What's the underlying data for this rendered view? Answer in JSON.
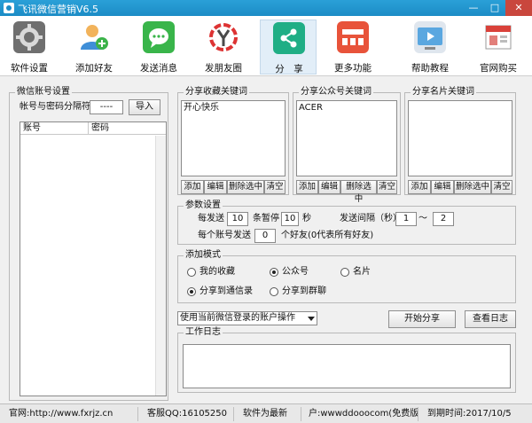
{
  "window": {
    "title": "飞讯微信营销V6.5",
    "minimize": "—",
    "maximize": "□",
    "close": "✕"
  },
  "toolbar": {
    "items": [
      {
        "label": "软件设置",
        "icon": "gear-icon"
      },
      {
        "label": "添加好友",
        "icon": "add-user-icon"
      },
      {
        "label": "发送消息",
        "icon": "chat-icon"
      },
      {
        "label": "发朋友圈",
        "icon": "moments-icon"
      },
      {
        "label": "分　享",
        "icon": "share-icon"
      },
      {
        "label": "更多功能",
        "icon": "more-icon"
      },
      {
        "label": "帮助教程",
        "icon": "help-video-icon"
      },
      {
        "label": "官网购买",
        "icon": "shop-icon"
      }
    ],
    "active": "分　享"
  },
  "accounts": {
    "group_title": "微信账号设置",
    "separator_label": "帐号与密码分隔符",
    "separator_value": "----",
    "import_label": "导入",
    "columns": [
      "账号",
      "密码"
    ]
  },
  "favorites_keywords": {
    "title": "分享收藏关键词",
    "items": [
      "开心快乐"
    ]
  },
  "public_keywords": {
    "title": "分享公众号关键词",
    "items": [
      "ACER"
    ]
  },
  "card_keywords": {
    "title": "分享名片关键词",
    "items": []
  },
  "list_buttons": {
    "add": "添加",
    "edit": "编辑",
    "delete": "删除选中",
    "clear": "清空"
  },
  "params": {
    "title": "参数设置",
    "every_send": "每发送",
    "send_count": "10",
    "pause_label": "条暂停",
    "pause_value": "10",
    "seconds": "秒",
    "interval_label": "发送间隔（秒）",
    "interval_min": "1",
    "tilde": "～",
    "interval_max": "2",
    "per_account": "每个账号发送",
    "per_account_value": "0",
    "per_account_note": "个好友(0代表所有好友)"
  },
  "mode": {
    "title": "添加模式",
    "options": [
      "我的收藏",
      "公众号",
      "名片"
    ],
    "selected": "公众号",
    "targets": [
      "分享到通信录",
      "分享到群聊"
    ],
    "target_selected": "分享到通信录"
  },
  "controls": {
    "account_select": "使用当前微信登录的账户操作",
    "start": "开始分享",
    "view_log": "查看日志"
  },
  "log": {
    "title": "工作日志"
  },
  "status": {
    "site": "官网:http://www.fxrjz.cn",
    "qq": "客服QQ:16105250",
    "version": "软件为最新",
    "user": "户:wwwddooocom(免费版",
    "expire": "到期时间:2017/10/5"
  },
  "colors": {
    "titlebar": "#1c8cc6",
    "close_button": "#c9473d",
    "active_tab": "#e2eef8"
  }
}
